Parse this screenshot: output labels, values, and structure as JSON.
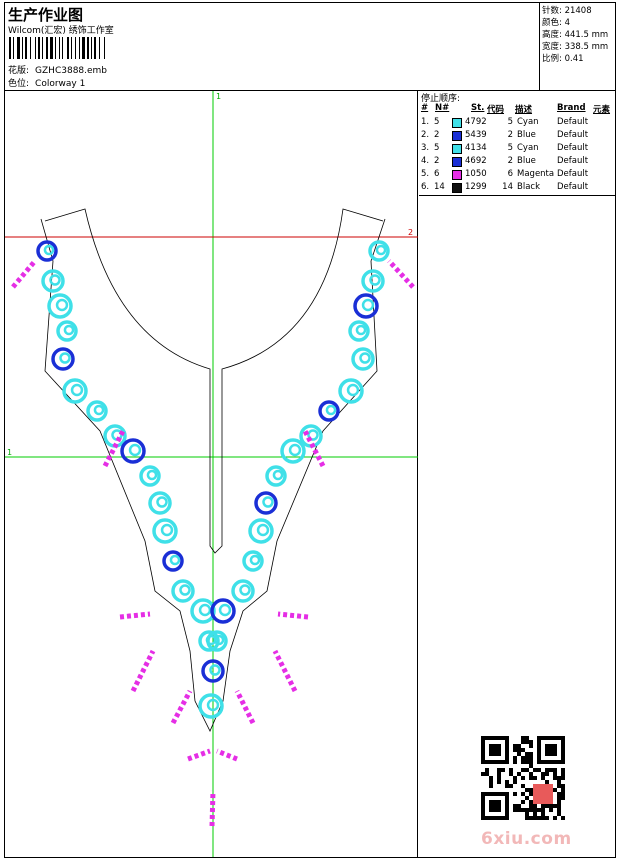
{
  "header": {
    "title": "生产作业图",
    "subtitle": "Wilcom(汇宏) 绣饰工作室",
    "design_label": "花版:",
    "design_value": "GZHC3888.emb",
    "colorway_label": "色位:",
    "colorway_value": "Colorway 1"
  },
  "specs": [
    {
      "label": "针数:",
      "value": "21408"
    },
    {
      "label": "颜色:",
      "value": "4"
    },
    {
      "label": "高度:",
      "value": "441.5 mm"
    },
    {
      "label": "宽度:",
      "value": "338.5 mm"
    },
    {
      "label": "比例:",
      "value": "0.41"
    }
  ],
  "stop_sequence": {
    "title": "停止顺序:",
    "columns": {
      "num": "#",
      "n": "N#",
      "st": "St.",
      "code": "代码",
      "desc": "描述",
      "brand": "Brand",
      "elem": "元素"
    },
    "rows": [
      {
        "num": "1.",
        "n": "5",
        "color": "#3fe0e8",
        "st": "4792",
        "code": "5",
        "desc": "Cyan",
        "brand": "Default"
      },
      {
        "num": "2.",
        "n": "2",
        "color": "#1a2fd6",
        "st": "5439",
        "code": "2",
        "desc": "Blue",
        "brand": "Default"
      },
      {
        "num": "3.",
        "n": "5",
        "color": "#3fe0e8",
        "st": "4134",
        "code": "5",
        "desc": "Cyan",
        "brand": "Default"
      },
      {
        "num": "4.",
        "n": "2",
        "color": "#1a2fd6",
        "st": "4692",
        "code": "2",
        "desc": "Blue",
        "brand": "Default"
      },
      {
        "num": "5.",
        "n": "6",
        "color": "#e52ee5",
        "st": "1050",
        "code": "6",
        "desc": "Magenta",
        "brand": "Default"
      },
      {
        "num": "6.",
        "n": "14",
        "color": "#111111",
        "st": "1299",
        "code": "14",
        "desc": "Black",
        "brand": "Default"
      }
    ]
  },
  "guides": {
    "vertical_label": "1",
    "horizontal_label": "1",
    "red_label": "2"
  },
  "watermark": "6xiu.com",
  "colors": {
    "guide_green": "#00cc00",
    "guide_red": "#cc0000",
    "cyan": "#3fe0e8",
    "blue": "#1a2fd6",
    "magenta": "#e52ee5"
  }
}
